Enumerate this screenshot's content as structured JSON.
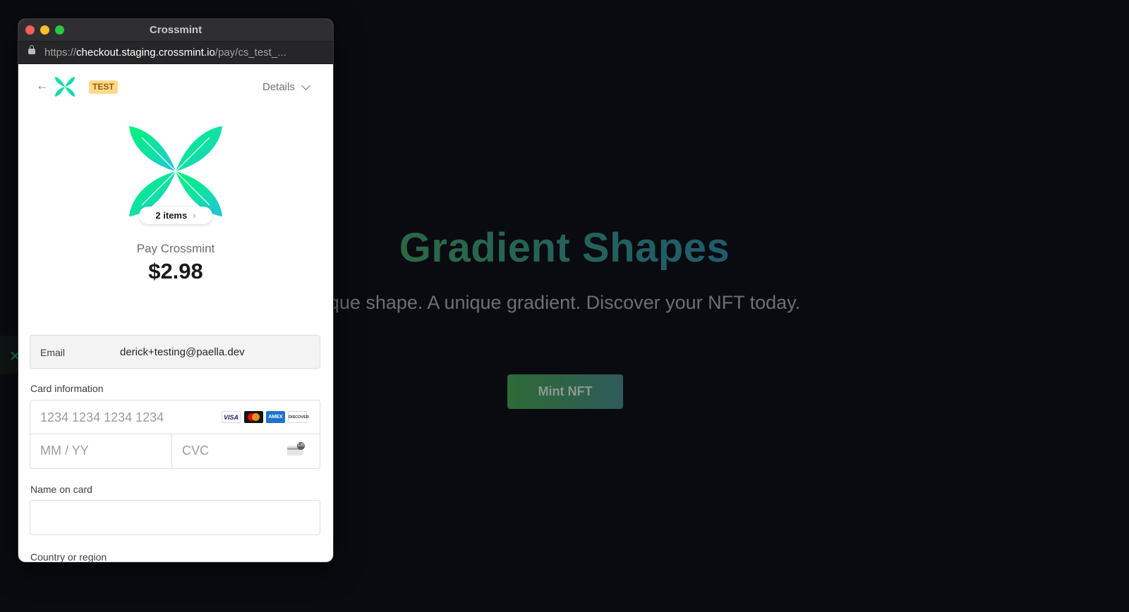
{
  "background": {
    "title": "Gradient Shapes",
    "subtitle": "que shape. A unique gradient. Discover your NFT today.",
    "mint_button": "Mint NFT"
  },
  "window": {
    "title": "Crossmint",
    "url_scheme": "https://",
    "url_host": "checkout.staging.crossmint.io",
    "url_path": "/pay/cs_test_..."
  },
  "checkout": {
    "badge": "TEST",
    "details_label": "Details",
    "items_label": "2 items",
    "pay_label": "Pay Crossmint",
    "amount": "$2.98",
    "email_label": "Email",
    "email_value": "derick+testing@paella.dev",
    "card_info_label": "Card information",
    "card_number_placeholder": "1234 1234 1234 1234",
    "expiry_placeholder": "MM / YY",
    "cvc_placeholder": "CVC",
    "name_on_card_label": "Name on card",
    "country_label": "Country or region",
    "card_brands": [
      "VISA",
      "AMEX",
      "DISCOVER"
    ],
    "icons": [
      "back-arrow-icon",
      "crossmint-logo-icon",
      "chevron-down-icon",
      "lock-icon",
      "mastercard-icon",
      "cvc-card-icon"
    ],
    "accent_colors": {
      "logo_green": "#00e88a",
      "logo_teal": "#1fd3c6",
      "badge": "#ffd98a"
    }
  }
}
